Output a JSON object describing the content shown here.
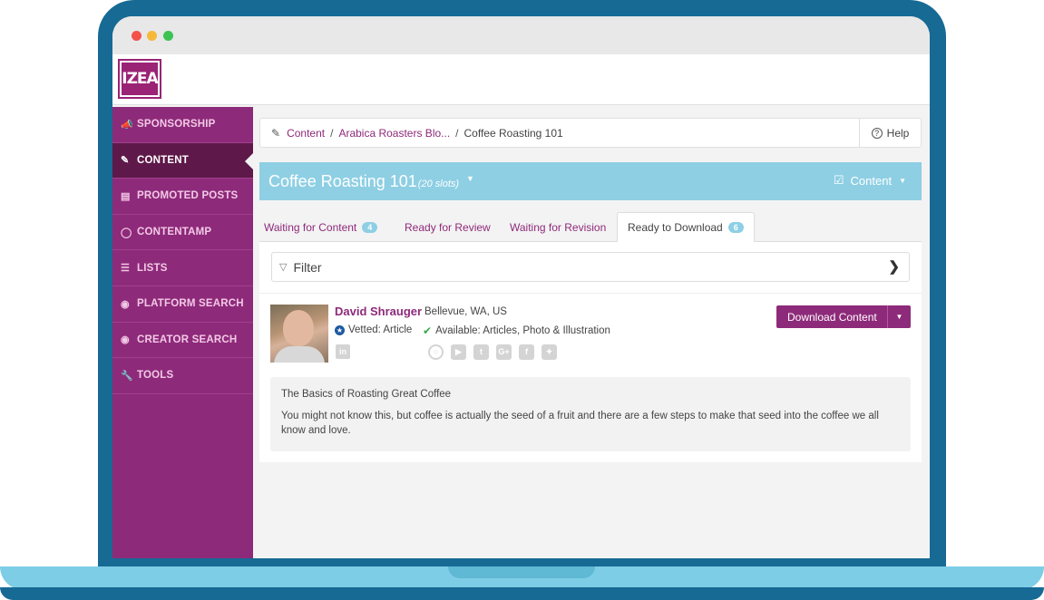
{
  "app": {
    "logo_text": "IZEA"
  },
  "sidebar": {
    "items": [
      {
        "label": "SPONSORSHIP",
        "icon": "megaphone-icon"
      },
      {
        "label": "CONTENT",
        "icon": "pencil-icon",
        "active": true
      },
      {
        "label": "PROMOTED POSTS",
        "icon": "promoted-icon"
      },
      {
        "label": "CONTENTAMP",
        "icon": "amp-icon"
      },
      {
        "label": "LISTS",
        "icon": "list-icon"
      },
      {
        "label": "PLATFORM SEARCH",
        "icon": "search-icon"
      },
      {
        "label": "CREATOR SEARCH",
        "icon": "creator-search-icon"
      },
      {
        "label": "TOOLS",
        "icon": "wrench-icon"
      }
    ]
  },
  "breadcrumb": {
    "items": [
      "Content",
      "Arabica Roasters Blo...",
      "Coffee Roasting 101"
    ],
    "separator": "/"
  },
  "help": {
    "label": "Help"
  },
  "header": {
    "title": "Coffee Roasting 101",
    "slots": "(20 slots)",
    "dropdown_label": "Content"
  },
  "tabs": [
    {
      "label": "Waiting for Content",
      "badge": "4"
    },
    {
      "label": "Ready for Review",
      "badge": ""
    },
    {
      "label": "Waiting for Revision",
      "badge": ""
    },
    {
      "label": "Ready to Download",
      "badge": "6",
      "active": true
    }
  ],
  "filter": {
    "label": "Filter"
  },
  "creator": {
    "name": "David Shrauger",
    "location": "Bellevue, WA, US",
    "vetted": "Vetted: Article",
    "available": "Available: Articles, Photo & Illustration",
    "linkedin": "in",
    "socials": [
      "instagram-icon",
      "youtube-icon",
      "tumblr-icon",
      "google-plus-icon",
      "facebook-icon",
      "twitter-icon"
    ]
  },
  "actions": {
    "download_label": "Download Content"
  },
  "content": {
    "title": "The Basics of Roasting Great Coffee",
    "body": "You might not know this, but coffee is actually the seed of a fruit and there are a few steps to make that seed into the coffee we all know and love."
  },
  "colors": {
    "brand": "#8e2a7a",
    "sidebar_active": "#5e1849",
    "header_bar": "#8ecfe4",
    "frame": "#166a94"
  }
}
